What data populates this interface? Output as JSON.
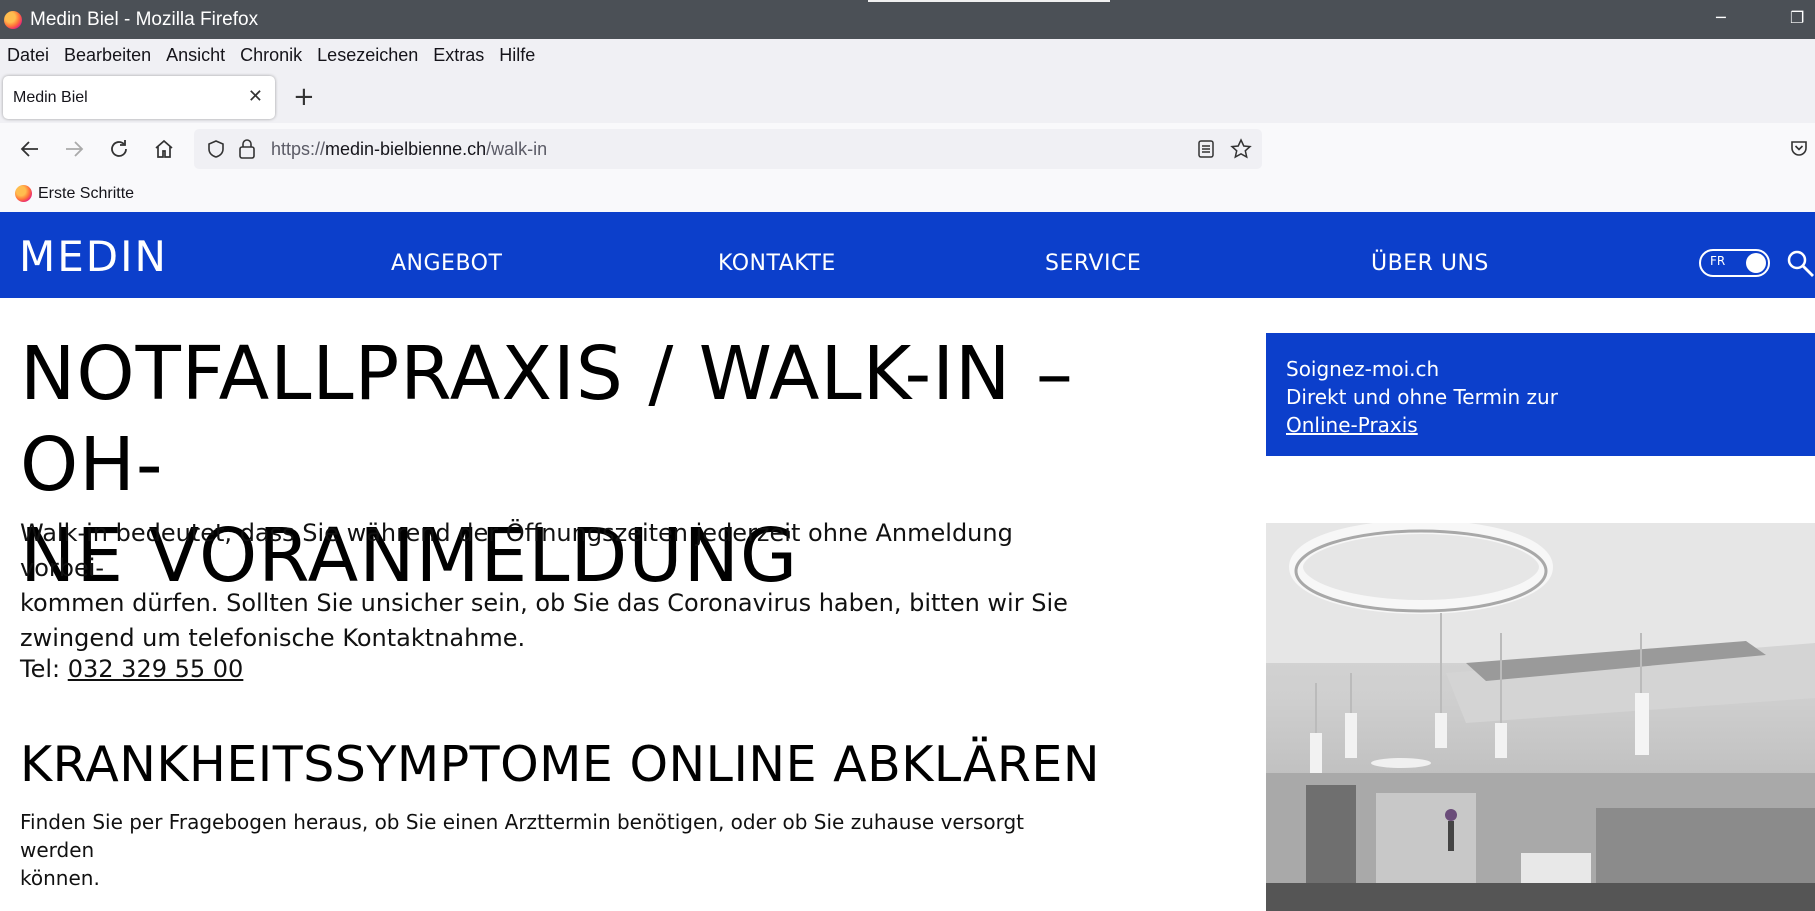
{
  "window": {
    "title": "Medin Biel - Mozilla Firefox"
  },
  "menu": [
    "Datei",
    "Bearbeiten",
    "Ansicht",
    "Chronik",
    "Lesezeichen",
    "Extras",
    "Hilfe"
  ],
  "tab": {
    "title": "Medin Biel"
  },
  "urlbar": {
    "prefix": "https://",
    "domain": "medin-bielbienne.ch",
    "path": "/walk-in"
  },
  "bookmarks": [
    {
      "label": "Erste Schritte"
    }
  ],
  "site": {
    "logo": "MEDIN",
    "nav": [
      "ANGEBOT",
      "KONTAKTE",
      "SERVICE",
      "ÜBER UNS"
    ],
    "lang": "FR"
  },
  "content": {
    "h1_line1": "NOTFALLPRAXIS / WALK-IN – OH-",
    "h1_line2": "NE VORANMELDUNG",
    "intro_line1": "Walk-in bedeutet, dass Sie während der Öffnungszeiten jederzeit ohne Anmeldung vorbei-",
    "intro_line2": "kommen dürfen. Sollten Sie unsicher sein, ob Sie das Coronavirus haben, bitten wir Sie",
    "intro_line3": "zwingend um telefonische Kontaktnahme.",
    "tel_label": "Tel: ",
    "tel_number": "032 329 55 00",
    "h2": "KRANKHEITSSYMPTOME ONLINE ABKLÄREN",
    "p2_line1": "Finden Sie per Fragebogen heraus, ob Sie einen Arzttermin benötigen, oder ob Sie zuhause versorgt werden",
    "p2_line2": "können."
  },
  "promo": {
    "line1": "Soignez-moi.ch",
    "line2": "Direkt und ohne Termin zur",
    "link": "Online-Praxis"
  },
  "colors": {
    "brand_blue": "#0c3fcb",
    "titlebar": "#4b5056"
  }
}
